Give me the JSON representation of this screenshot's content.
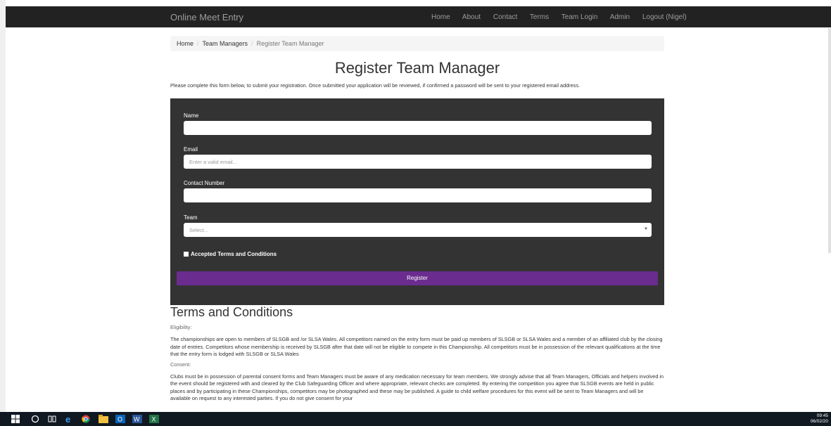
{
  "navbar": {
    "brand": "Online Meet Entry",
    "links": [
      "Home",
      "About",
      "Contact",
      "Terms",
      "Team Login",
      "Admin",
      "Logout (Nigel)"
    ]
  },
  "breadcrumb": {
    "items": [
      "Home",
      "Team Managers"
    ],
    "active": "Register Team Manager"
  },
  "page": {
    "title": "Register Team Manager",
    "intro": "Please complete this form below, to submit your registration. Once submitted your application will be reviewed, if confirmed a password will be sent to your registered email address."
  },
  "form": {
    "name_label": "Name",
    "name_value": "",
    "email_label": "Email",
    "email_placeholder": "Enter a valid email...",
    "contact_label": "Contact Number",
    "contact_value": "",
    "team_label": "Team",
    "team_selected": "Select...",
    "terms_checkbox_label": "Accepted Terms and Conditions",
    "register_label": "Register",
    "register_color": "#6a2c8e"
  },
  "terms": {
    "heading": "Terms and Conditions",
    "eligibility_heading": "Eligibility:",
    "eligibility_text": "The championships are open to members of SLSGB and /or SLSA Wales. All competitors named on the entry form must be paid up members of SLSGB or SLSA Wales and a member of an affiliated club by the closing date of entries. Competitors whose membership is received by SLSGB after that date will not be eligible to compete in this Championship. All competitors must be in possession of the relevant qualifications at the time that the entry form is lodged with SLSGB or SLSA Wales",
    "consent_heading": "Consent:",
    "consent_text": "Clubs must be in possession of parental consent forms and Team Managers must be aware of any medication necessary for team members. We strongly advise that all Team Managers, Officials and helpers involved in the event should be registered with and cleared by the Club Safeguarding Officer and where appropriate, relevant checks are completed. By entering the competition you agree that SLSGB events are held in public places and by participating in these Championships, competitors may be photographed and these may be published. A guide to child welfare procedures for this event will be sent to Team Managers and will be available on request to any interested parties. If you do not give consent for your"
  },
  "taskbar": {
    "icons": [
      "windows-start-icon",
      "search-icon",
      "task-view-icon",
      "edge-icon",
      "chrome-icon",
      "file-explorer-icon",
      "outlook-icon",
      "word-icon",
      "excel-icon"
    ],
    "time": "09:45",
    "date": "06/02/20"
  }
}
